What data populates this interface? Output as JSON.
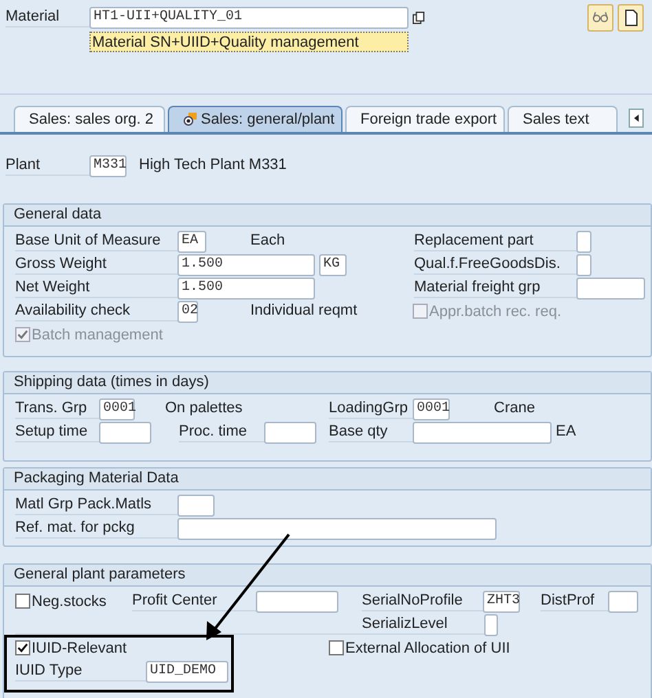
{
  "material": {
    "label": "Material",
    "value": "HT1-UII+QUALITY_01",
    "description": "Material SN+UIID+Quality management"
  },
  "tabs": [
    {
      "label": "Sales: sales org. 2",
      "selected": false
    },
    {
      "label": "Sales: general/plant",
      "selected": true
    },
    {
      "label": "Foreign trade export",
      "selected": false
    },
    {
      "label": "Sales text",
      "selected": false
    }
  ],
  "plant": {
    "label": "Plant",
    "value": "M331",
    "name": "High Tech Plant M331"
  },
  "general_data": {
    "title": "General data",
    "base_uom": {
      "label": "Base Unit of Measure",
      "value": "EA",
      "text": "Each"
    },
    "replacement_part": {
      "label": "Replacement part"
    },
    "gross_weight": {
      "label": "Gross Weight",
      "value": "1.500",
      "unit": "KG"
    },
    "qual_free_goods": {
      "label": "Qual.f.FreeGoodsDis."
    },
    "net_weight": {
      "label": "Net Weight",
      "value": "1.500"
    },
    "freight_grp": {
      "label": "Material freight grp"
    },
    "availability": {
      "label": "Availability check",
      "value": "02",
      "text": "Individual reqmt"
    },
    "appr_batch": {
      "label": "Appr.batch rec. req.",
      "checked": false,
      "disabled": true
    },
    "batch_management": {
      "label": "Batch management",
      "checked": true,
      "disabled": true
    }
  },
  "shipping_data": {
    "title": "Shipping data (times in days)",
    "trans_grp": {
      "label": "Trans. Grp",
      "value": "0001",
      "text": "On palettes"
    },
    "loading_grp": {
      "label": "LoadingGrp",
      "value": "0001",
      "text": "Crane"
    },
    "setup_time": {
      "label": "Setup time"
    },
    "proc_time": {
      "label": "Proc. time"
    },
    "base_qty": {
      "label": "Base qty",
      "unit": "EA"
    }
  },
  "packaging": {
    "title": "Packaging Material Data",
    "matl_grp": {
      "label": "Matl Grp Pack.Matls"
    },
    "ref_mat": {
      "label": "Ref. mat. for pckg"
    }
  },
  "plant_params": {
    "title": "General plant parameters",
    "neg_stocks": {
      "label": "Neg.stocks",
      "checked": false,
      "disabled": false
    },
    "profit_center": {
      "label": "Profit Center"
    },
    "serial_profile": {
      "label": "SerialNoProfile",
      "value": "ZHT3"
    },
    "dist_prof": {
      "label": "DistProf"
    },
    "serializ_level": {
      "label": "SerializLevel"
    },
    "iuid_relevant": {
      "label": "IUID-Relevant",
      "checked": true,
      "disabled": false
    },
    "ext_alloc": {
      "label": "External Allocation of UII",
      "checked": false,
      "disabled": false
    },
    "iuid_type": {
      "label": "IUID Type",
      "value": "UID_DEMO"
    }
  }
}
